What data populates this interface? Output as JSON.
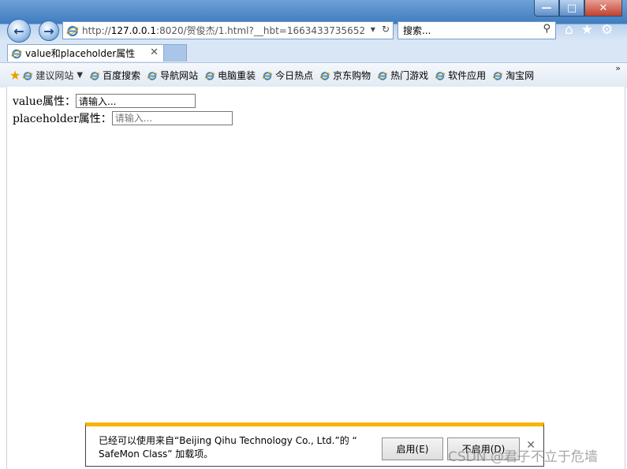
{
  "window": {
    "min_label": "—",
    "max_label": "□",
    "close_label": "✕"
  },
  "nav": {
    "back_icon": "←",
    "fwd_icon": "→",
    "url_prefix": "http://",
    "url_host": "127.0.0.1",
    "url_rest": ":8020/贺俊杰/1.html?__hbt=1663433735652",
    "dropdown_icon": "▾",
    "refresh_icon": "↻",
    "search_placeholder": "搜索...",
    "search_icon": "⚲",
    "home_icon": "⌂",
    "favorites_icon": "★",
    "tools_icon": "⚙"
  },
  "tab": {
    "title": "value和placeholder属性",
    "close": "✕"
  },
  "favbar": {
    "star_icon": "★",
    "first": "建议网站",
    "items": [
      "百度搜索",
      "导航网站",
      "电脑重装",
      "今日热点",
      "京东购物",
      "热门游戏",
      "软件应用",
      "淘宝网"
    ],
    "more": "»"
  },
  "content": {
    "label1": "value属性：",
    "value1": "请输入...",
    "label2": "placeholder属性：",
    "placeholder2": "请输入..."
  },
  "notice": {
    "line1": "已经可以使用来自“Beijing Qihu Technology Co., Ltd.”的 “",
    "line2": "SafeMon Class” 加载项。",
    "enable": "启用(E)",
    "disable": "不启用(D)",
    "close": "✕"
  },
  "watermark": "CSDN @君子不立于危墙",
  "colors": {
    "accent": "#3f7cc0",
    "notice_bar": "#f7b400"
  }
}
